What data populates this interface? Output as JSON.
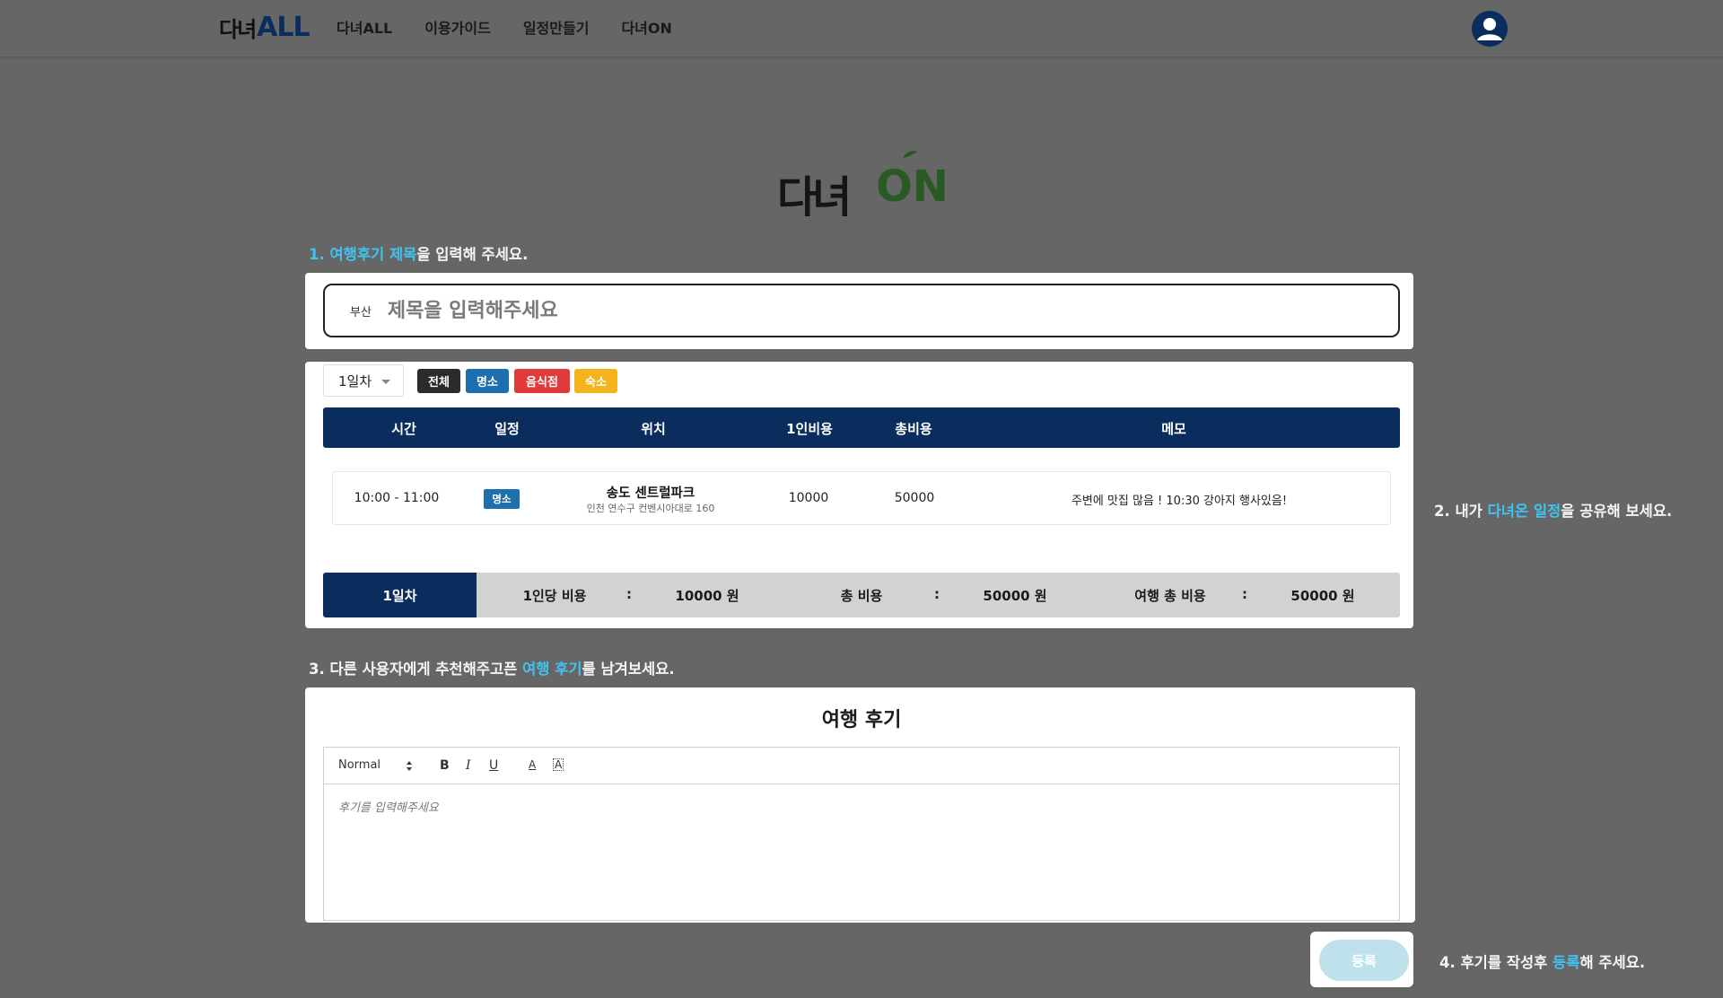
{
  "nav": {
    "logo_korean": "다녀",
    "logo_all": "ALL",
    "items": [
      "다녀ALL",
      "이용가이드",
      "일정만들기",
      "다녀ON"
    ]
  },
  "hero": {
    "korean": "다녀",
    "on": "ON"
  },
  "steps": {
    "s1_pre": "1. ",
    "s1_hl": "여행후기  제목",
    "s1_post": "을 입력해 주세요.",
    "s2_pre": "2. 내가 ",
    "s2_hl": "다녀온 일정",
    "s2_post": "을 공유해 보세요.",
    "s3_pre": "3. 다른 사용자에게 추천해주고픈 ",
    "s3_hl": "여행 후기",
    "s3_post": "를 남겨보세요.",
    "s4_pre": "4. 후기를 작성후 ",
    "s4_hl": "등록",
    "s4_post": "해 주세요."
  },
  "title_field": {
    "region": "부산",
    "placeholder": "제목을 입력해주세요",
    "value": ""
  },
  "day_select": {
    "selected": "1일차"
  },
  "filters": [
    "전체",
    "명소",
    "음식점",
    "숙소"
  ],
  "filter_colors": {
    "all": "#2b2b2b",
    "place": "#1d6fae",
    "food": "#e23a3a",
    "stay": "#f3b41c"
  },
  "table": {
    "headers": [
      "시간",
      "일정",
      "위치",
      "1인비용",
      "총비용",
      "메모"
    ],
    "rows": [
      {
        "time": "10:00 - 11:00",
        "type": "명소",
        "place": "송도 센트럴파크",
        "address": "인천 연수구 컨벤시아대로 160",
        "per_person": "10000",
        "total": "50000",
        "memo": "주변에 맛집 많음 ! 10:30 강아지 행사있음!"
      }
    ]
  },
  "summary": {
    "day": "1일차",
    "per_person_label": "1인당 비용",
    "per_person_value": "10000 원",
    "total_label": "총 비용",
    "total_value": "50000 원",
    "trip_total_label": "여행 총 비용",
    "trip_total_value": "50000 원",
    "colon": ":"
  },
  "review": {
    "title": "여행 후기",
    "toolbar": {
      "format": "Normal",
      "bold": "B",
      "italic": "I",
      "underline": "U",
      "color": "A",
      "background": "A"
    },
    "placeholder": "후기를 입력해주세요"
  },
  "submit": {
    "label": "등록"
  },
  "colors": {
    "navy": "#0b2d5e",
    "highlight": "#3fc3f0",
    "leaf_green": "#2a5a24"
  }
}
